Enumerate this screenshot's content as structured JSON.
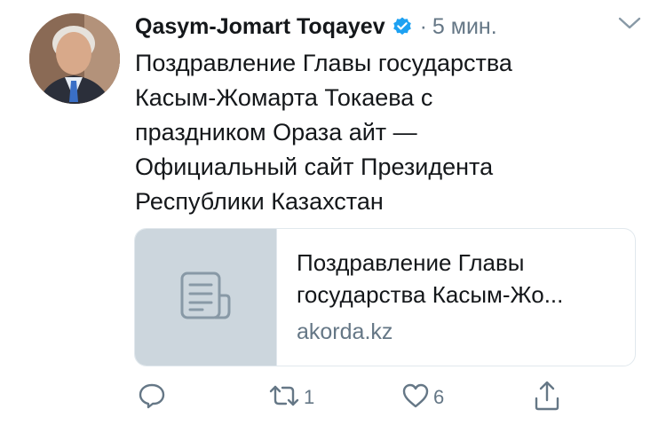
{
  "tweet": {
    "author_name": "Qasym-Jomart Toqayev",
    "verified": true,
    "separator": "·",
    "time": "5 мин.",
    "text_lines": [
      "Поздравление Главы государства",
      "Касым-Жомарта Токаева с",
      "праздником Ораза айт —",
      "Официальный сайт Президента",
      "Республики Казахстан"
    ]
  },
  "card": {
    "title_lines": [
      "Поздравление Главы",
      "государства Касым-Жо..."
    ],
    "domain": "akorda.kz",
    "thumbnail_icon": "document-icon"
  },
  "actions": {
    "reply": {
      "icon": "reply-icon",
      "count": ""
    },
    "retweet": {
      "icon": "retweet-icon",
      "count": "1"
    },
    "like": {
      "icon": "heart-icon",
      "count": "6"
    },
    "share": {
      "icon": "share-icon",
      "count": ""
    }
  },
  "colors": {
    "text": "#14171a",
    "secondary": "#657786",
    "verified": "#1da1f2",
    "card_border": "#e1e8ed",
    "card_thumb": "#ccd6dd"
  }
}
